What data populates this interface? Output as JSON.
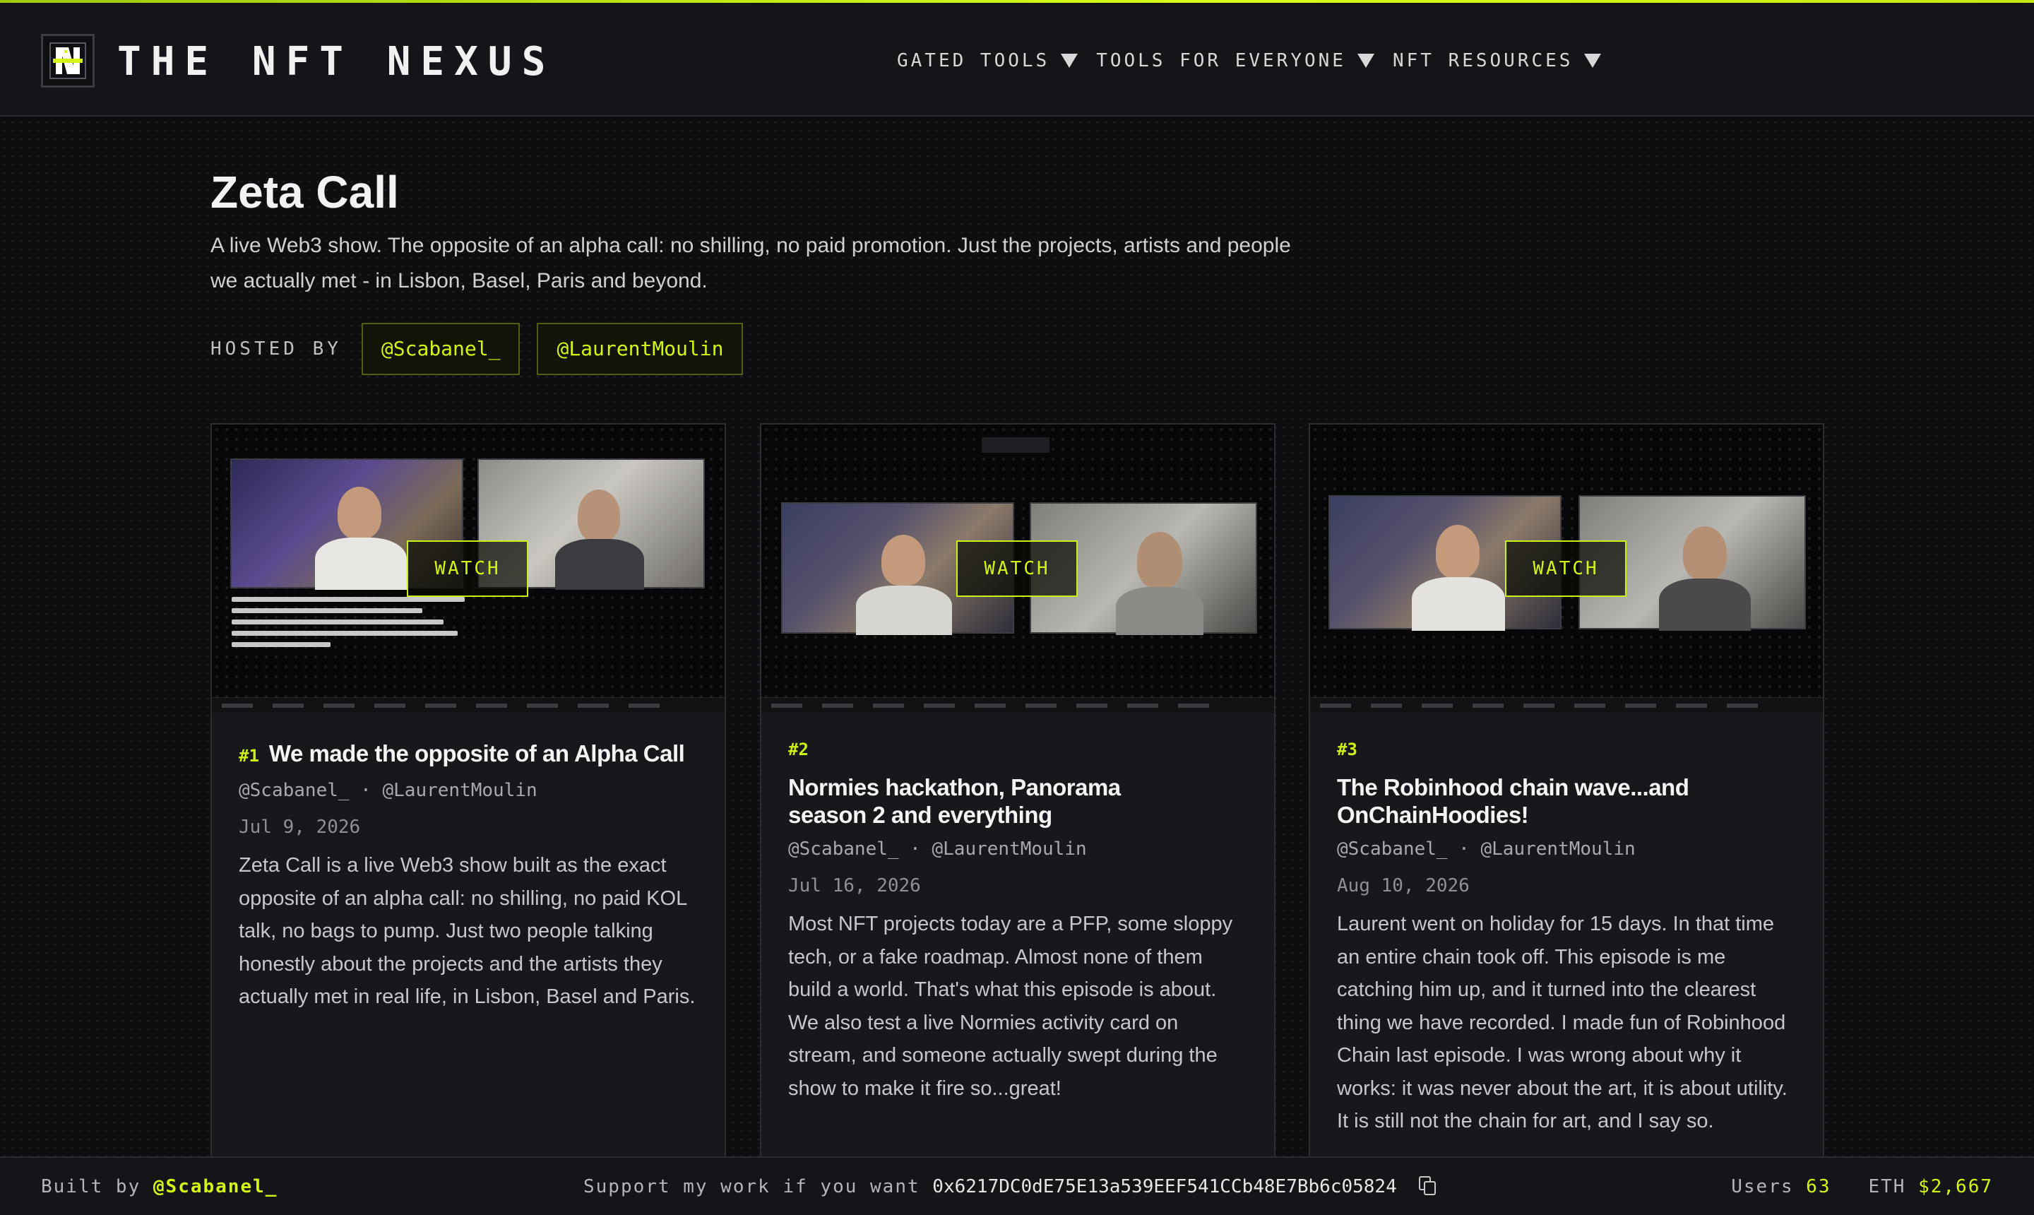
{
  "brand": {
    "name": "THE NFT NEXUS",
    "logo_icon": "nexus-logo-icon"
  },
  "nav": {
    "items": [
      {
        "label": "GATED TOOLS"
      },
      {
        "label": "TOOLS FOR EVERYONE"
      },
      {
        "label": "NFT RESOURCES"
      }
    ]
  },
  "page": {
    "title": "Zeta Call",
    "description": "A live Web3 show. The opposite of an alpha call: no shilling, no paid promotion. Just the projects, artists and people we actually met - in Lisbon, Basel, Paris and beyond.",
    "hosted_by_label": "HOSTED BY",
    "hosts": [
      "@Scabanel_",
      "@LaurentMoulin"
    ]
  },
  "episodes": [
    {
      "number": "#1",
      "title": "We made the opposite of an Alpha Call",
      "hosts": "@Scabanel_ · @LaurentMoulin",
      "date": "Jul 9, 2026",
      "summary": "Zeta Call is a live Web3 show built as the exact opposite of an alpha call: no shilling, no paid KOL talk, no bags to pump. Just two people talking honestly about the projects and the artists they actually met in real life, in Lisbon, Basel and Paris.",
      "watch_label": "WATCH"
    },
    {
      "number": "#2",
      "title": "Normies hackathon, Panorama season 2 and everything",
      "hosts": "@Scabanel_ · @LaurentMoulin",
      "date": "Jul 16, 2026",
      "summary": "Most NFT projects today are a PFP, some sloppy tech, or a fake roadmap. Almost none of them build a world. That's what this episode is about. We also test a live Normies activity card on stream, and someone actually swept during the show to make it fire so...great!",
      "watch_label": "WATCH"
    },
    {
      "number": "#3",
      "title": "The Robinhood chain wave...and OnChainHoodies!",
      "hosts": "@Scabanel_ · @LaurentMoulin",
      "date": "Aug 10, 2026",
      "summary": "Laurent went on holiday for 15 days. In that time an entire chain took off. This episode is me catching him up, and it turned into the clearest thing we have recorded. I made fun of Robinhood Chain last episode. I was wrong about why it works: it was never about the art, it is about utility. It is still not the chain for art, and I say so.",
      "watch_label": "WATCH"
    }
  ],
  "footer": {
    "built_by_label": "Built by",
    "built_by_handle": "@Scabanel_",
    "support_label": "Support my work if you want",
    "wallet_address": "0x6217DC0dE75E13a539EEF541CCb48E7Bb6c05824",
    "users_label": "Users",
    "users_count": "63",
    "eth_label": "ETH",
    "eth_price": "$2,667"
  },
  "colors": {
    "accent": "#d4f516",
    "background": "#0d0e10",
    "card": "#17181c"
  }
}
